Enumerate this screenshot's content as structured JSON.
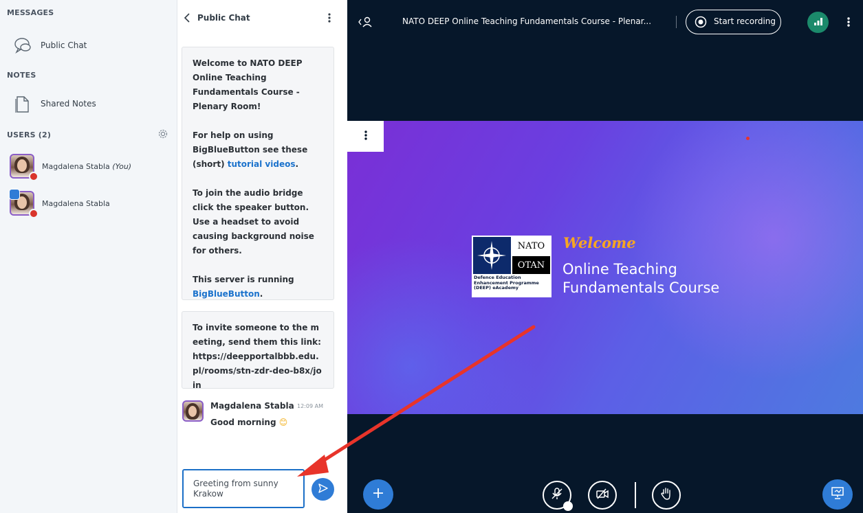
{
  "sidebar": {
    "messages_title": "MESSAGES",
    "public_chat_label": "Public Chat",
    "notes_title": "NOTES",
    "shared_notes_label": "Shared Notes",
    "users_title": "USERS (2)",
    "users": [
      {
        "name": "Magdalena Stabla",
        "suffix": "(You)"
      },
      {
        "name": "Magdalena Stabla",
        "suffix": ""
      }
    ]
  },
  "chat": {
    "title": "Public Chat",
    "welcome": {
      "line1": "Welcome to NATO DEEP Online Teaching Fundamentals Course - Plenary Room!",
      "help_prefix": "For help on using BigBlueButton see these (short) ",
      "help_link": "tutorial videos",
      "help_suffix": ".",
      "audio": "To join the audio bridge click the speaker button. Use a headset to avoid causing background noise for others.",
      "server_prefix": "This server is running ",
      "server_link": "BigBlueButton",
      "server_suffix": "."
    },
    "invite": "To invite someone to the meeting, send them this link: https://deepportalbbb.edu.pl/rooms/stn-zdr-deo-b8x/join",
    "message": {
      "author": "Magdalena Stabla",
      "time": "12:09 AM",
      "text": "Good morning",
      "emoji": "😊"
    },
    "input_value": "Greeting from sunny Krakow"
  },
  "main": {
    "meeting_title": "NATO DEEP Online Teaching Fundamentals Course - Plenar...",
    "record_label": "Start recording",
    "slide": {
      "logo_nato": "NATO",
      "logo_otan": "OTAN",
      "logo_caption": "Defence Education Enhancement Programme (DEEP) eAcademy",
      "welcome": "Welcome",
      "line1": "Online Teaching",
      "line2": "Fundamentals Course"
    }
  },
  "colors": {
    "accent": "#2f7cd6",
    "record_icon": "#ffffff",
    "connection": "#1b8a6b",
    "slide_start": "#7a2fd6",
    "slide_end": "#4e7ae0",
    "welcome_text": "#f6a623",
    "arrow": "#e8342a"
  },
  "icons": [
    "chat-bubble-icon",
    "shared-notes-icon",
    "gear-icon",
    "back-chevron-icon",
    "more-vertical-icon",
    "user-list-icon",
    "record-icon",
    "connection-status-icon",
    "plus-icon",
    "mic-muted-icon",
    "camera-off-icon",
    "raise-hand-icon",
    "presentation-icon",
    "send-icon"
  ]
}
